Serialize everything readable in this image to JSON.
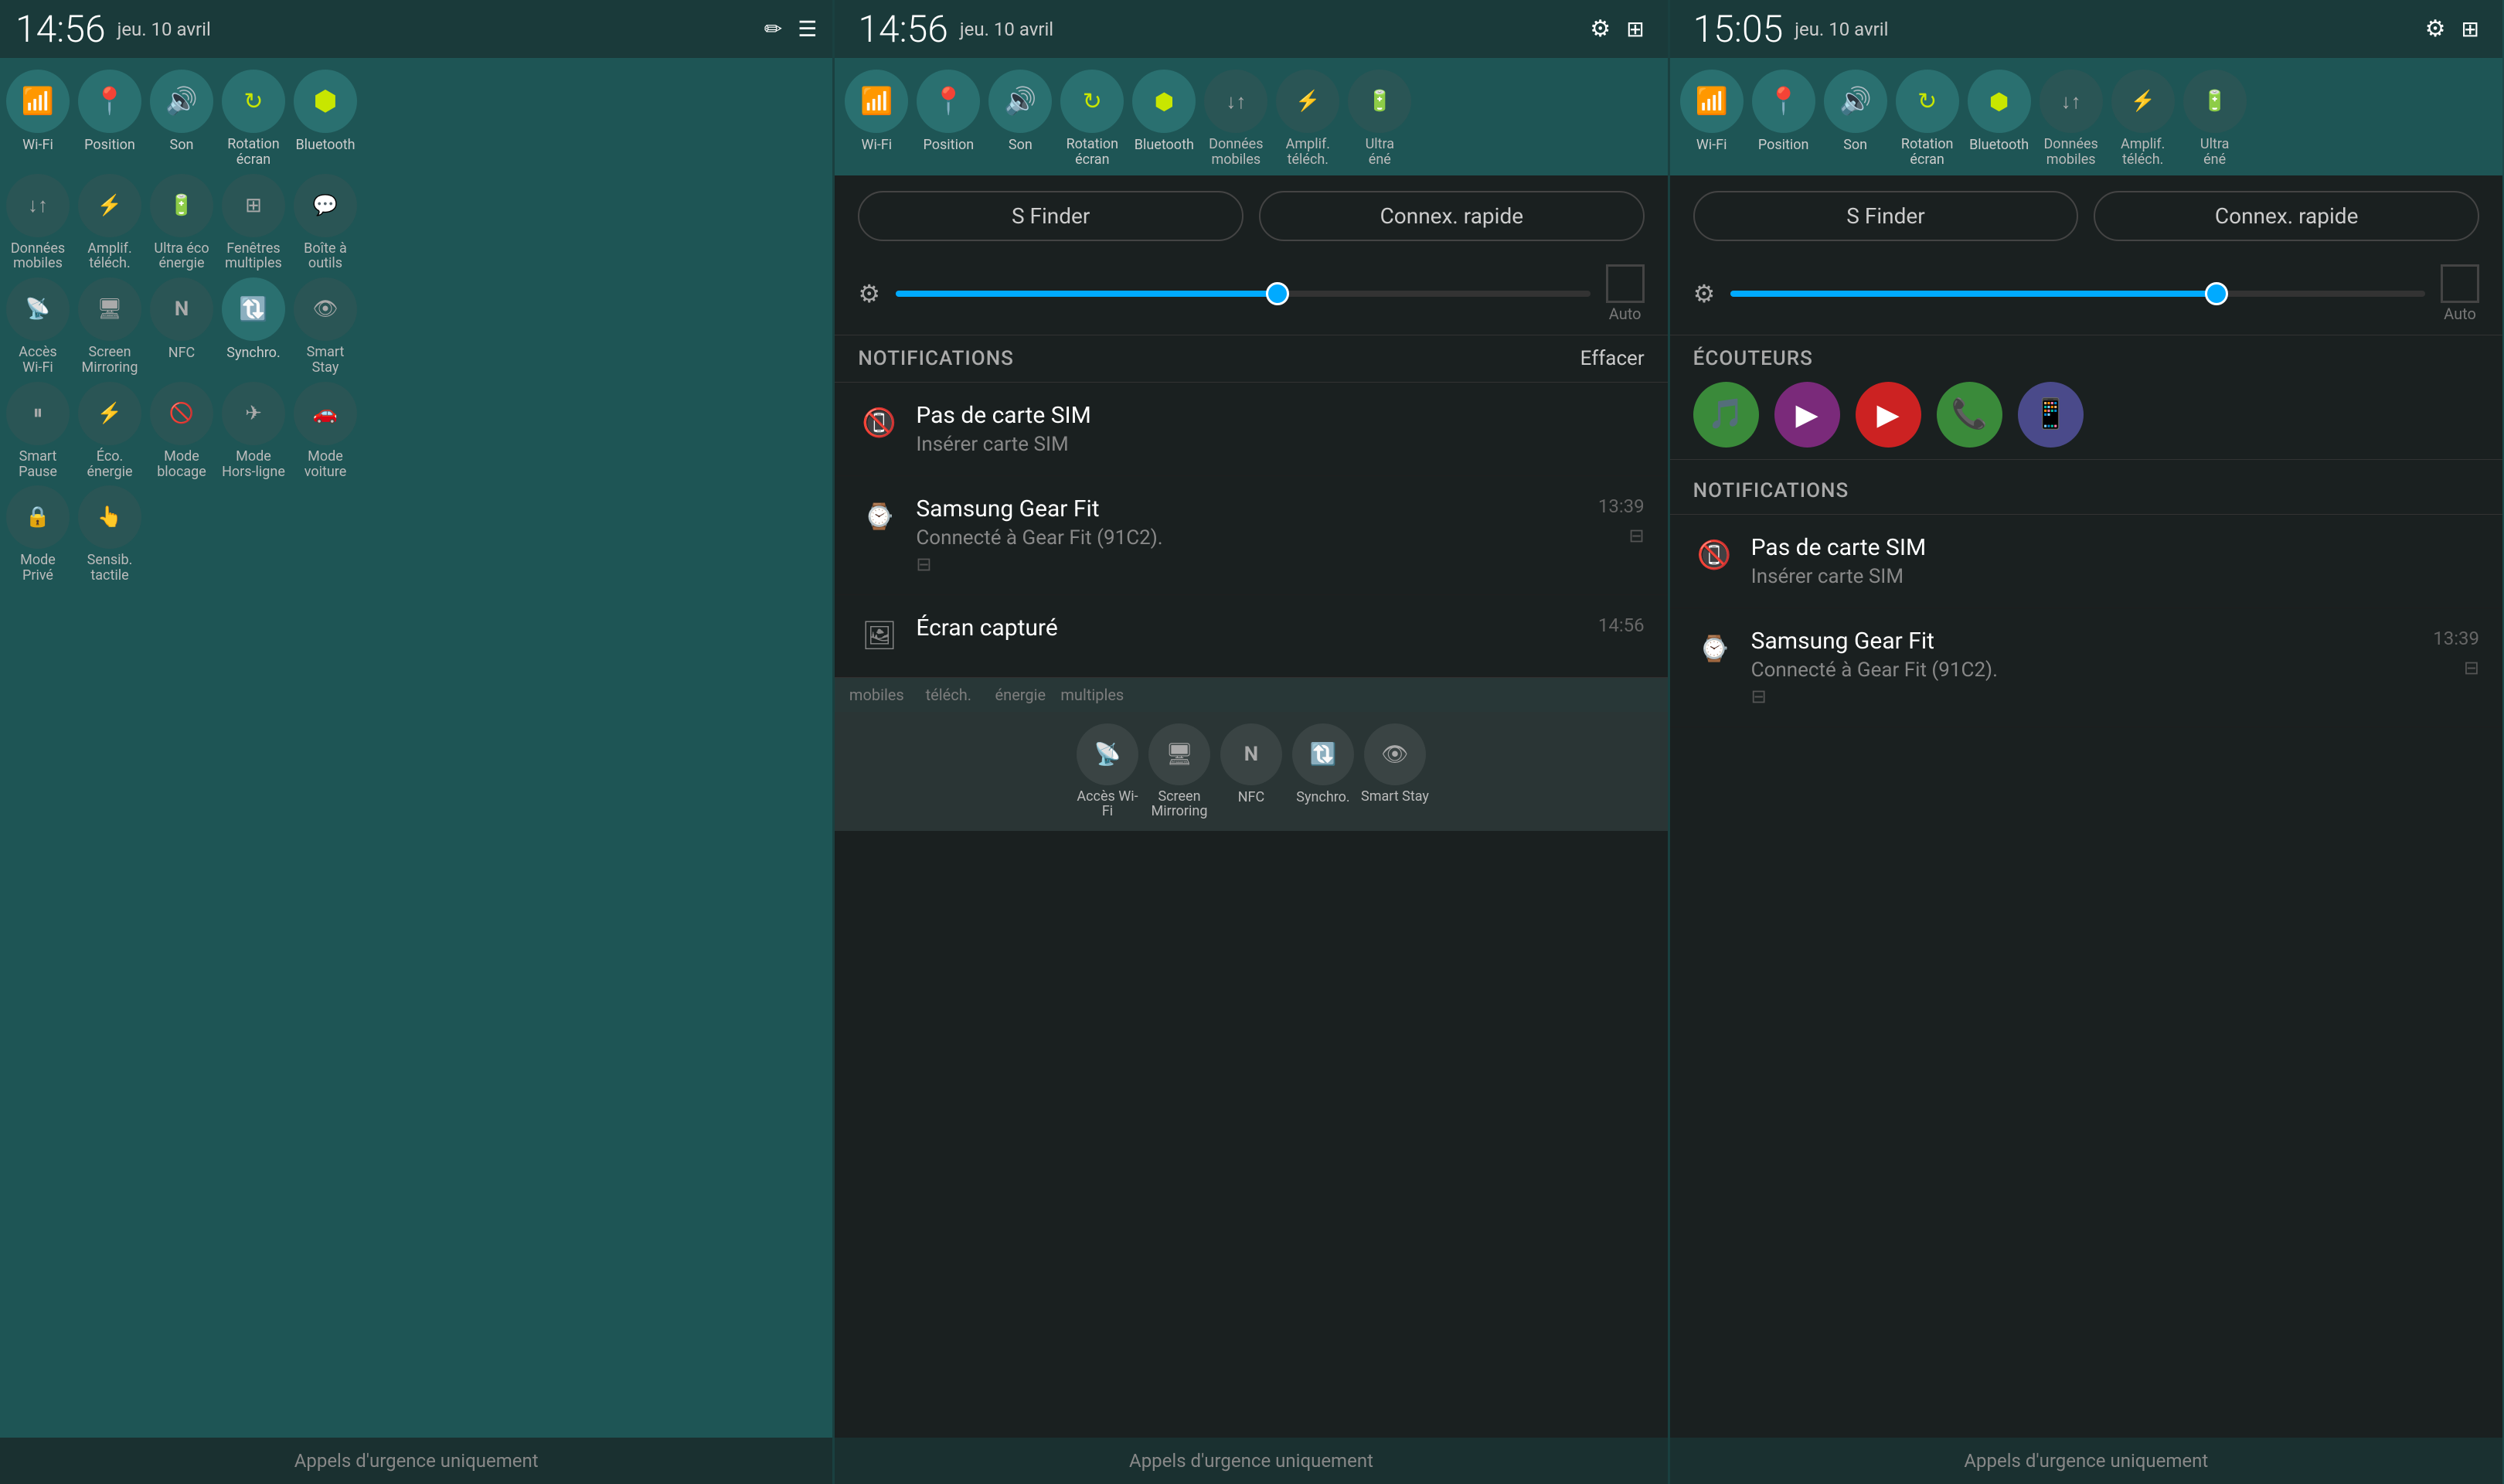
{
  "panels": [
    {
      "id": "panel-1",
      "statusBar": {
        "time": "14:56",
        "date": "jeu. 10 avril",
        "icons": [
          "pencil-icon",
          "list-icon"
        ]
      },
      "quickSettings": {
        "rows": [
          [
            {
              "id": "wifi",
              "label": "Wi-Fi",
              "icon": "📶",
              "active": true
            },
            {
              "id": "position",
              "label": "Position",
              "icon": "📍",
              "active": true
            },
            {
              "id": "son",
              "label": "Son",
              "icon": "🔊",
              "active": true
            },
            {
              "id": "rotation",
              "label": "Rotation écran",
              "icon": "🔄",
              "active": true
            },
            {
              "id": "bluetooth",
              "label": "Bluetooth",
              "icon": "⟨B⟩",
              "active": true
            }
          ],
          [
            {
              "id": "donnees",
              "label": "Données mobiles",
              "icon": "↓↑",
              "active": false
            },
            {
              "id": "amplif",
              "label": "Amplif. téléch.",
              "icon": "⚡",
              "active": false
            },
            {
              "id": "ultra",
              "label": "Ultra éco énergie",
              "icon": "🔋",
              "active": false
            },
            {
              "id": "fenetres",
              "label": "Fenêtres multiples",
              "icon": "⊞",
              "active": false
            },
            {
              "id": "boite",
              "label": "Boîte à outils",
              "icon": "💬",
              "active": false
            }
          ],
          [
            {
              "id": "acces-wifi",
              "label": "Accès Wi-Fi",
              "icon": "📡",
              "active": false
            },
            {
              "id": "screen-mirror",
              "label": "Screen Mirroring",
              "icon": "🖥",
              "active": false
            },
            {
              "id": "nfc",
              "label": "NFC",
              "icon": "N",
              "active": false
            },
            {
              "id": "synchro",
              "label": "Synchro.",
              "icon": "🔃",
              "active": true
            },
            {
              "id": "smart-stay",
              "label": "Smart Stay",
              "icon": "👁",
              "active": false
            }
          ],
          [
            {
              "id": "smart-pause",
              "label": "Smart Pause",
              "icon": "⏸",
              "active": false
            },
            {
              "id": "eco-energie",
              "label": "Éco. énergie",
              "icon": "⚡",
              "active": false
            },
            {
              "id": "mode-blocage",
              "label": "Mode blocage",
              "icon": "🚫",
              "active": false
            },
            {
              "id": "mode-hors-ligne",
              "label": "Mode Hors-ligne",
              "icon": "✈",
              "active": false
            },
            {
              "id": "mode-voiture",
              "label": "Mode voiture",
              "icon": "🚗",
              "active": false
            }
          ],
          [
            {
              "id": "mode-prive",
              "label": "Mode Privé",
              "icon": "🔒",
              "active": false
            },
            {
              "id": "sensib",
              "label": "Sensib. tactile",
              "icon": "👆",
              "active": false
            }
          ]
        ]
      },
      "bottomBar": {
        "text": "Appels d'urgence uniquement"
      }
    },
    {
      "id": "panel-2",
      "statusBar": {
        "time": "14:56",
        "date": "jeu. 10 avril",
        "icons": [
          "gear-icon",
          "grid-icon"
        ]
      },
      "finderButtons": [
        {
          "id": "s-finder",
          "label": "S Finder"
        },
        {
          "id": "connex-rapide",
          "label": "Connex. rapide"
        }
      ],
      "brightness": {
        "fillPercent": 55,
        "autoLabel": "Auto"
      },
      "notifications": {
        "title": "NOTIFICATIONS",
        "clearLabel": "Effacer",
        "items": [
          {
            "id": "no-sim",
            "icon": "sim-card-icon",
            "appName": "Pas de carte SIM",
            "text": "Insérer carte SIM",
            "time": "",
            "hasAction": false
          },
          {
            "id": "gear-fit",
            "icon": "gear-fit-icon",
            "appName": "Samsung Gear Fit",
            "text": "Connecté à Gear Fit (91C2).",
            "time": "13:39",
            "hasAction": true
          },
          {
            "id": "screenshot",
            "icon": "screenshot-icon",
            "appName": "Écran capturé",
            "text": "",
            "time": "14:56",
            "hasAction": false
          }
        ]
      },
      "partialQS": {
        "labels": [
          "mobiles",
          "téléch.",
          "énergie",
          "multiples"
        ]
      },
      "overlayQS": {
        "items": [
          {
            "id": "acces-wifi2",
            "label": "Accès Wi-Fi",
            "icon": "📡"
          },
          {
            "id": "screen-mirror2",
            "label": "Screen Mirroring",
            "icon": "🖥"
          },
          {
            "id": "nfc2",
            "label": "NFC",
            "icon": "N"
          },
          {
            "id": "synchro2",
            "label": "Synchro.",
            "icon": "🔃"
          },
          {
            "id": "smart-stay2",
            "label": "Smart Stay",
            "icon": "👁"
          }
        ]
      },
      "bottomBar": {
        "text": "Appels d'urgence uniquement"
      }
    },
    {
      "id": "panel-3",
      "statusBar": {
        "time": "15:05",
        "date": "jeu. 10 avril",
        "icons": [
          "gear-icon",
          "grid-icon"
        ]
      },
      "finderButtons": [
        {
          "id": "s-finder2",
          "label": "S Finder"
        },
        {
          "id": "connex-rapide2",
          "label": "Connex. rapide"
        }
      ],
      "brightness": {
        "fillPercent": 70,
        "autoLabel": "Auto"
      },
      "earphones": {
        "title": "ÉCOUTEURS",
        "apps": [
          {
            "id": "music-app",
            "icon": "🎵",
            "color": "#3a8a3a",
            "label": "Music"
          },
          {
            "id": "video-app",
            "icon": "▶",
            "color": "#7a2a7a",
            "label": "Video"
          },
          {
            "id": "youtube-app",
            "icon": "▶",
            "color": "#cc2222",
            "label": "YouTube"
          },
          {
            "id": "phone-app",
            "icon": "📞",
            "color": "#3a8a3a",
            "label": "Phone"
          },
          {
            "id": "remote-app",
            "icon": "📱",
            "color": "#4a4a8a",
            "label": "Remote"
          }
        ]
      },
      "notifications": {
        "title": "NOTIFICATIONS",
        "items": [
          {
            "id": "no-sim2",
            "icon": "sim-card-icon",
            "appName": "Pas de carte SIM",
            "text": "Insérer carte SIM",
            "time": "",
            "hasAction": false
          },
          {
            "id": "gear-fit2",
            "icon": "gear-fit-icon",
            "appName": "Samsung Gear Fit",
            "text": "Connecté à Gear Fit (91C2).",
            "time": "13:39",
            "hasAction": true
          }
        ]
      },
      "quickSettings": {
        "topRow": [
          {
            "id": "wifi3",
            "label": "Wi-Fi",
            "icon": "📶",
            "active": true
          },
          {
            "id": "position3",
            "label": "Position",
            "icon": "📍",
            "active": true
          },
          {
            "id": "son3",
            "label": "Son",
            "icon": "🔊",
            "active": true
          },
          {
            "id": "rotation3",
            "label": "Rotation écran",
            "icon": "🔄",
            "active": true
          },
          {
            "id": "bluetooth3",
            "label": "Bluetooth",
            "icon": "B",
            "active": true
          }
        ],
        "secondRow": [
          {
            "id": "donnees3",
            "label": "Données mobiles",
            "icon": "↓↑",
            "active": false
          },
          {
            "id": "amplif3",
            "label": "Amplif. téléch.",
            "icon": "⚡",
            "active": false
          },
          {
            "id": "ultra3",
            "label": "Ultra éne",
            "icon": "🔋",
            "active": false
          }
        ]
      },
      "bottomBar": {
        "text": "Appels d'urgence uniquement"
      }
    }
  ],
  "icons": {
    "wifi": "wifi-icon",
    "bluetooth": "bluetooth-icon",
    "pencil": "✏",
    "list": "☰",
    "gear": "⚙",
    "grid": "⊞",
    "sim": "📵",
    "gearfit": "⌚",
    "screenshot": "🖼"
  }
}
